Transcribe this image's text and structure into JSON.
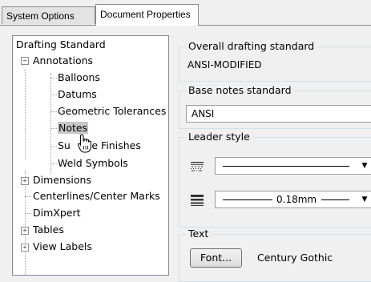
{
  "tabs": [
    {
      "label": "System Options",
      "active": false
    },
    {
      "label": "Document Properties",
      "active": true
    }
  ],
  "tree": {
    "items": [
      {
        "label": "Drafting Standard"
      },
      {
        "label": "Annotations",
        "expander": "−"
      },
      {
        "label": "Balloons"
      },
      {
        "label": "Datums"
      },
      {
        "label": "Geometric Tolerances"
      },
      {
        "label": "Notes",
        "selected": true
      },
      {
        "label": "Surface Finishes",
        "partial": [
          "Su",
          "ace Finishes"
        ]
      },
      {
        "label": "Weld Symbols"
      },
      {
        "label": "Dimensions",
        "expander": "+"
      },
      {
        "label": "Centerlines/Center Marks"
      },
      {
        "label": "DimXpert"
      },
      {
        "label": "Tables",
        "expander": "+"
      },
      {
        "label": "View Labels",
        "expander": "+"
      }
    ]
  },
  "panel": {
    "overall": {
      "label": "Overall drafting standard",
      "value": "ANSI-MODIFIED"
    },
    "base_notes": {
      "label": "Base notes standard",
      "value": "ANSI"
    },
    "leader": {
      "label": "Leader style",
      "thickness": "0.18mm"
    },
    "text": {
      "label": "Text",
      "font_button": "Font...",
      "font_name": "Century Gothic"
    }
  },
  "icons": {
    "line_style": "line-style-icon",
    "line_thickness": "line-thickness-icon",
    "dropdown": "dropdown-arrow-icon",
    "cursor": "hand-pointer-icon"
  }
}
